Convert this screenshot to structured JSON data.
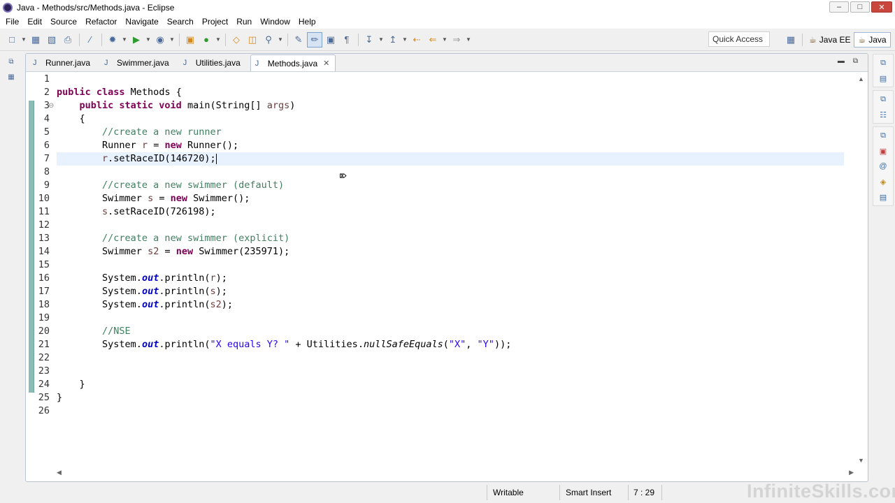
{
  "window": {
    "title": "Java - Methods/src/Methods.java - Eclipse",
    "minimize": "–",
    "maximize": "□",
    "close": "✕"
  },
  "menu": [
    "File",
    "Edit",
    "Source",
    "Refactor",
    "Navigate",
    "Search",
    "Project",
    "Run",
    "Window",
    "Help"
  ],
  "toolbar": {
    "quick_access": "Quick Access",
    "perspectives": [
      {
        "label": "Java EE",
        "icon": "java-ee-perspective-icon",
        "active": false
      },
      {
        "label": "Java",
        "icon": "java-perspective-icon",
        "active": true
      }
    ]
  },
  "tabs": [
    {
      "label": "Runner.java",
      "active": false
    },
    {
      "label": "Swimmer.java",
      "active": false
    },
    {
      "label": "Utilities.java",
      "active": false
    },
    {
      "label": "Methods.java",
      "active": true
    }
  ],
  "editor": {
    "line_numbers": [
      "1",
      "2",
      "3",
      "4",
      "5",
      "6",
      "7",
      "8",
      "9",
      "10",
      "11",
      "12",
      "13",
      "14",
      "15",
      "16",
      "17",
      "18",
      "19",
      "20",
      "21",
      "22",
      "23",
      "24",
      "25",
      "26"
    ],
    "current_line": 7,
    "code": {
      "l2_kw": "public class",
      "l2_rest": " Methods {",
      "l3_kw": "public static void",
      "l3_mid": " main(String[] ",
      "l3_var": "args",
      "l3_end": ")",
      "l4": "{",
      "l5": "//create a new runner",
      "l6_a": "Runner ",
      "l6_var": "r",
      "l6_b": " = ",
      "l6_kw": "new",
      "l6_c": " Runner();",
      "l7_var": "r",
      "l7_b": ".setRaceID(146720);",
      "l9": "//create a new swimmer (default)",
      "l10_a": "Swimmer ",
      "l10_var": "s",
      "l10_b": " = ",
      "l10_kw": "new",
      "l10_c": " Swimmer();",
      "l11_var": "s",
      "l11_b": ".setRaceID(726198);",
      "l13": "//create a new swimmer (explicit)",
      "l14_a": "Swimmer ",
      "l14_var": "s2",
      "l14_b": " = ",
      "l14_kw": "new",
      "l14_c": " Swimmer(235971);",
      "sys": "System.",
      "out": "out",
      "println_open": ".println(",
      "close_paren": ");",
      "l16_var": "r",
      "l17_var": "s",
      "l18_var": "s2",
      "l20": "//NSE",
      "l21_a": ".println(",
      "l21_str1": "\"X equals Y? \"",
      "l21_b": " + Utilities.",
      "l21_method": "nullSafeEquals",
      "l21_c": "(",
      "l21_str2": "\"X\"",
      "l21_d": ", ",
      "l21_str3": "\"Y\"",
      "l21_e": "));",
      "l24": "}",
      "l25": "}"
    }
  },
  "status": {
    "writable": "Writable",
    "insert_mode": "Smart Insert",
    "position": "7 : 29"
  },
  "watermark": "InfiniteSkills.com",
  "colors": {
    "keyword": "#7f0055",
    "comment": "#3f7f5f",
    "string": "#2a00ff",
    "field": "#0000c0",
    "current_line": "#e8f2fe"
  }
}
